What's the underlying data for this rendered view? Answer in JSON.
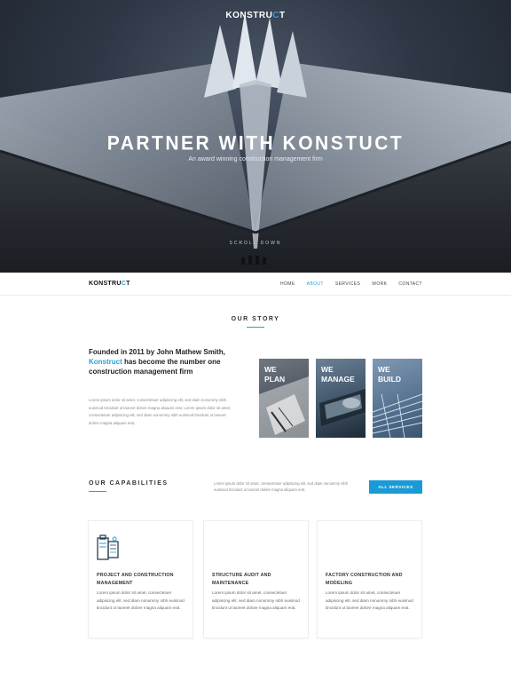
{
  "hero": {
    "logo_prefix": "KONSTRU",
    "logo_accent": "C",
    "logo_suffix": "T",
    "title": "PARTNER WITH KONSTUCT",
    "subtitle": "An award winning construction management firm",
    "scroll_label": "SCROLL DOWN"
  },
  "nav": {
    "logo_prefix": "KONSTRU",
    "logo_accent": "C",
    "logo_suffix": "T",
    "links": [
      "HOME",
      "ABOUT",
      "SERVICES",
      "WORK",
      "CONTACT"
    ],
    "active": "ABOUT"
  },
  "story": {
    "title": "OUR STORY",
    "headline_part1": "Founded in 2011 by John Mathew Smith,",
    "headline_accent": "Konstruct",
    "headline_part2": "has become the number one construction management firm",
    "body": "Lorem ipsum dolor sit amet, consectetuer adipiscing elit, sed diam nonummy nibh euismod tincidunt ut laoreet dolore magna aliquam erat. Lorem ipsum dolor sit amet, consectetuer adipiscing elit, sed diam nonummy nibh euismod tincidunt ut laoreet dolore magna aliquam erat.",
    "tiles": [
      {
        "line1": "WE",
        "line2": "PLAN"
      },
      {
        "line1": "WE",
        "line2": "MANAGE"
      },
      {
        "line1": "WE",
        "line2": "BUILD"
      }
    ]
  },
  "capabilities": {
    "title": "OUR CAPABILITIES",
    "description": "Lorem ipsum dolor sit amet, consectetuer adipiscing elit, sed diam nonummy nibh euismod tincidunt ut laoreet dolore magna aliquam erat.",
    "button_label": "ALL SERVICES",
    "cards": [
      {
        "title": "PROJECT AND CONSTRUCTION MANAGEMENT",
        "text": "Lorem ipsum dolor sit amet, consectetuer adipiscing elit, sed diam nonummy nibh euismod tincidunt ut laoreet dolore magna aliquam erat.",
        "icon": "blueprint-clipboard-icon"
      },
      {
        "title": "STRUCTURE AUDIT AND MAINTENANCE",
        "text": "Lorem ipsum dolor sit amet, consectetuer adipiscing elit, sed diam nonummy nibh euismod tincidunt ut laoreet dolore magna aliquam erat."
      },
      {
        "title": "FACTORY CONSTRUCTION AND MODELING",
        "text": "Lorem ipsum dolor sit amet, consectetuer adipiscing elit, sed diam nonummy nibh euismod tincidunt ut laoreet dolore magna aliquam erat."
      }
    ]
  },
  "colors": {
    "accent": "#2a9fd8",
    "button": "#1a9bd7"
  }
}
